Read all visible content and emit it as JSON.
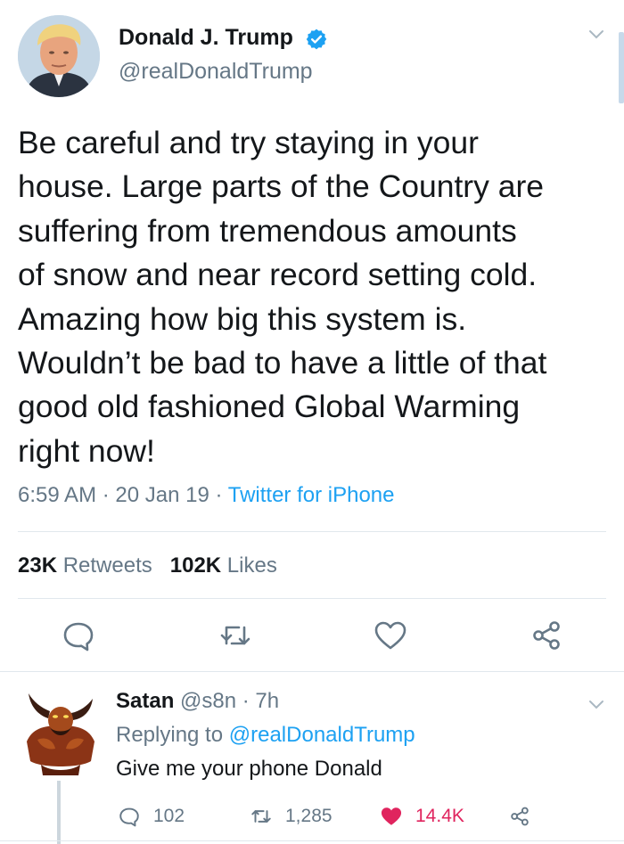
{
  "tweet": {
    "author_name": "Donald J. Trump",
    "author_handle": "@realDonaldTrump",
    "text": "Be careful and try staying in your\nhouse. Large parts of the Country are\nsuffering from  tremendous amounts\nof snow and near record setting cold.\nAmazing how big this system is.\nWouldn’t be bad to have a little of that\ngood old fashioned Global Warming\nright now!",
    "time": "6:59 AM",
    "date": "20 Jan 19",
    "source": "Twitter for iPhone",
    "retweets_count": "23K",
    "retweets_label": "Retweets",
    "likes_count": "102K",
    "likes_label": "Likes",
    "icons": {
      "verified": "verified-badge-icon",
      "menu": "chevron-down-icon",
      "reply": "reply-bubble-icon",
      "retweet": "retweet-arrows-icon",
      "like": "heart-outline-icon",
      "share": "share-nodes-icon"
    }
  },
  "reply": {
    "author_name": "Satan",
    "author_handle": "@s8n",
    "time_ago": "7h",
    "replying_prefix": "Replying to",
    "replying_to": "@realDonaldTrump",
    "text": "Give me your phone Donald",
    "reply_count": "102",
    "retweet_count": "1,285",
    "like_count": "14.4K",
    "liked": true
  },
  "colors": {
    "link": "#1da1f2",
    "secondary_text": "#657786",
    "primary_text": "#14171a",
    "divider": "#e1e8ed",
    "like_active": "#e0245e"
  }
}
